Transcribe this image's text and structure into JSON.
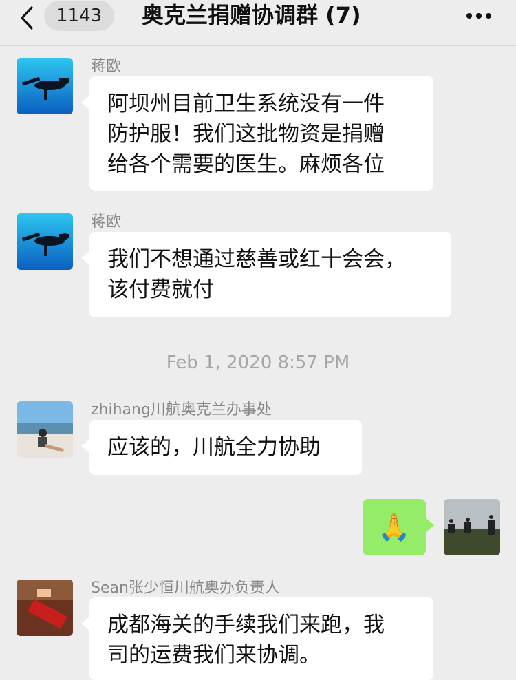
{
  "header": {
    "back_badge": "1143",
    "title": "奥克兰捐赠协调群 (7)",
    "icons": {
      "back": "chevron-left-icon",
      "more": "more-dots-icon"
    }
  },
  "messages": [
    {
      "sender": "蒋欧",
      "avatar": "underwater-diver-avatar",
      "lines": [
        "阿坝州目前卫生系统没有一件",
        "防护服！我们这批物资是捐赠",
        "给各个需要的医生。麻烦各位"
      ]
    },
    {
      "sender": "蒋欧",
      "avatar": "underwater-diver-avatar",
      "lines": [
        "我们不想通过慈善或红十会会，",
        "该付费就付"
      ]
    },
    {
      "sender": "zhihang川航奥克兰办事处",
      "avatar": "beach-person-avatar",
      "lines": [
        "应该的，川航全力协助"
      ]
    },
    {
      "sender": "Sean张少恒川航奥办负责人",
      "avatar": "red-object-avatar",
      "lines": [
        "成都海关的手续我们来跑，我",
        "司的运费我们来协调。"
      ]
    }
  ],
  "timestamp": "Feb 1, 2020 8:57 PM",
  "own_message": {
    "emoji": "🙏",
    "avatar": "horse-riders-avatar"
  },
  "colors": {
    "background": "#ededed",
    "incoming_bubble": "#ffffff",
    "outgoing_bubble": "#95ec69",
    "sender_text": "#888888"
  }
}
